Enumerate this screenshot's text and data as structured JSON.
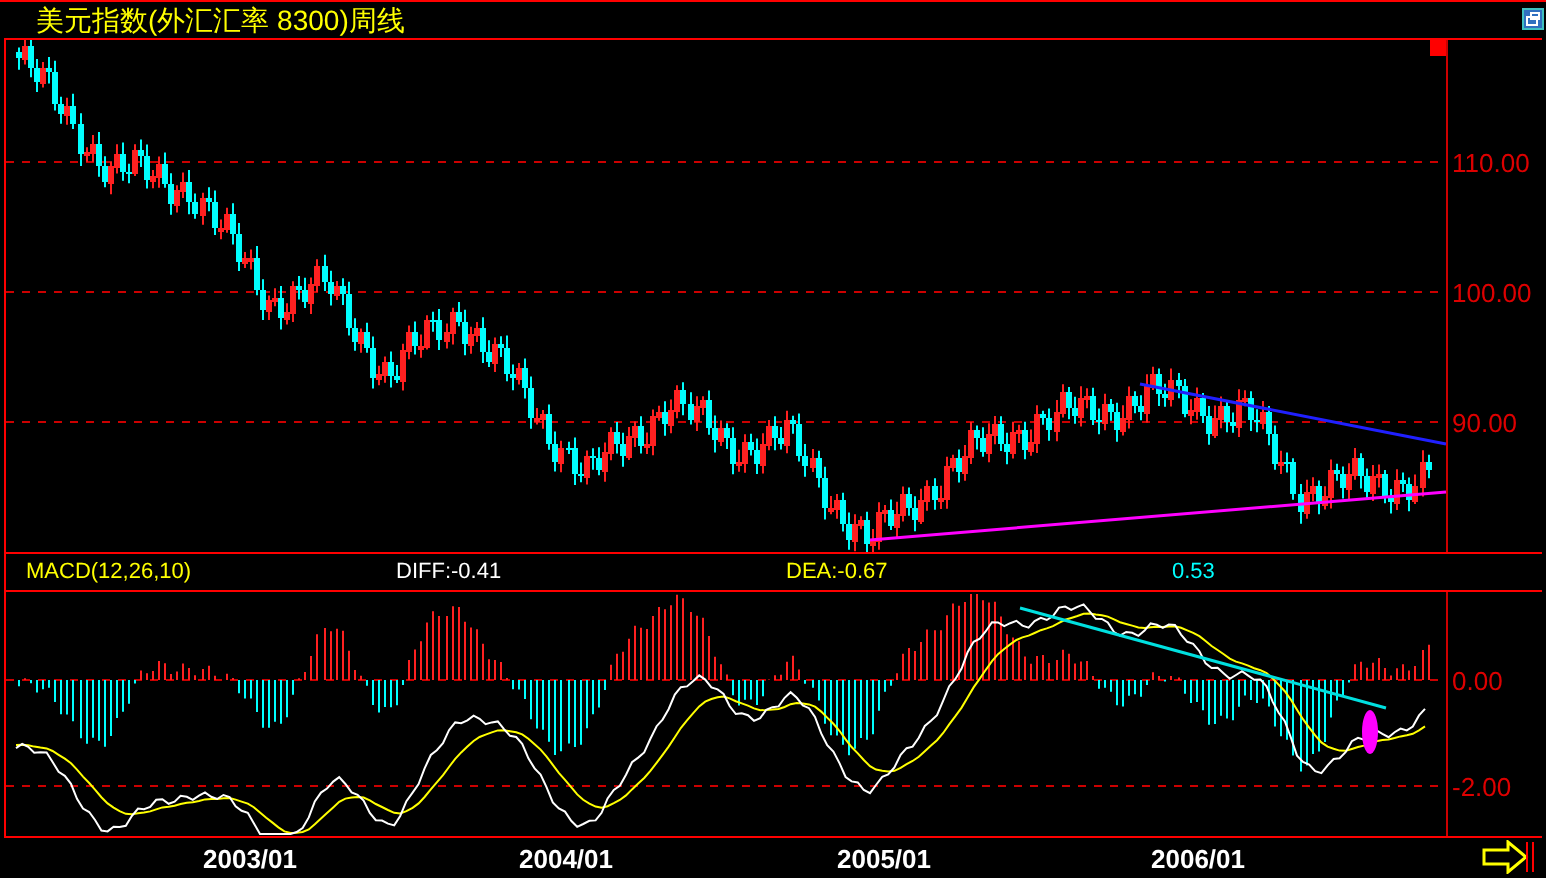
{
  "title": "美元指数(外汇汇率 8300)周线",
  "price_axis": [
    "110.00",
    "100.00",
    "90.00"
  ],
  "indicator": [
    {
      "text": "MACD(12,26,10)",
      "color": "#ffff00"
    },
    {
      "text": "DIFF:-0.41",
      "color": "#ffffff"
    },
    {
      "text": "DEA:-0.67",
      "color": "#ffff00"
    },
    {
      "text": "0.53",
      "color": "#00ffff"
    }
  ],
  "macd_axis": [
    "0.00",
    "-2.00"
  ],
  "dates": [
    "2003/01",
    "2004/01",
    "2005/01",
    "2006/01"
  ]
}
